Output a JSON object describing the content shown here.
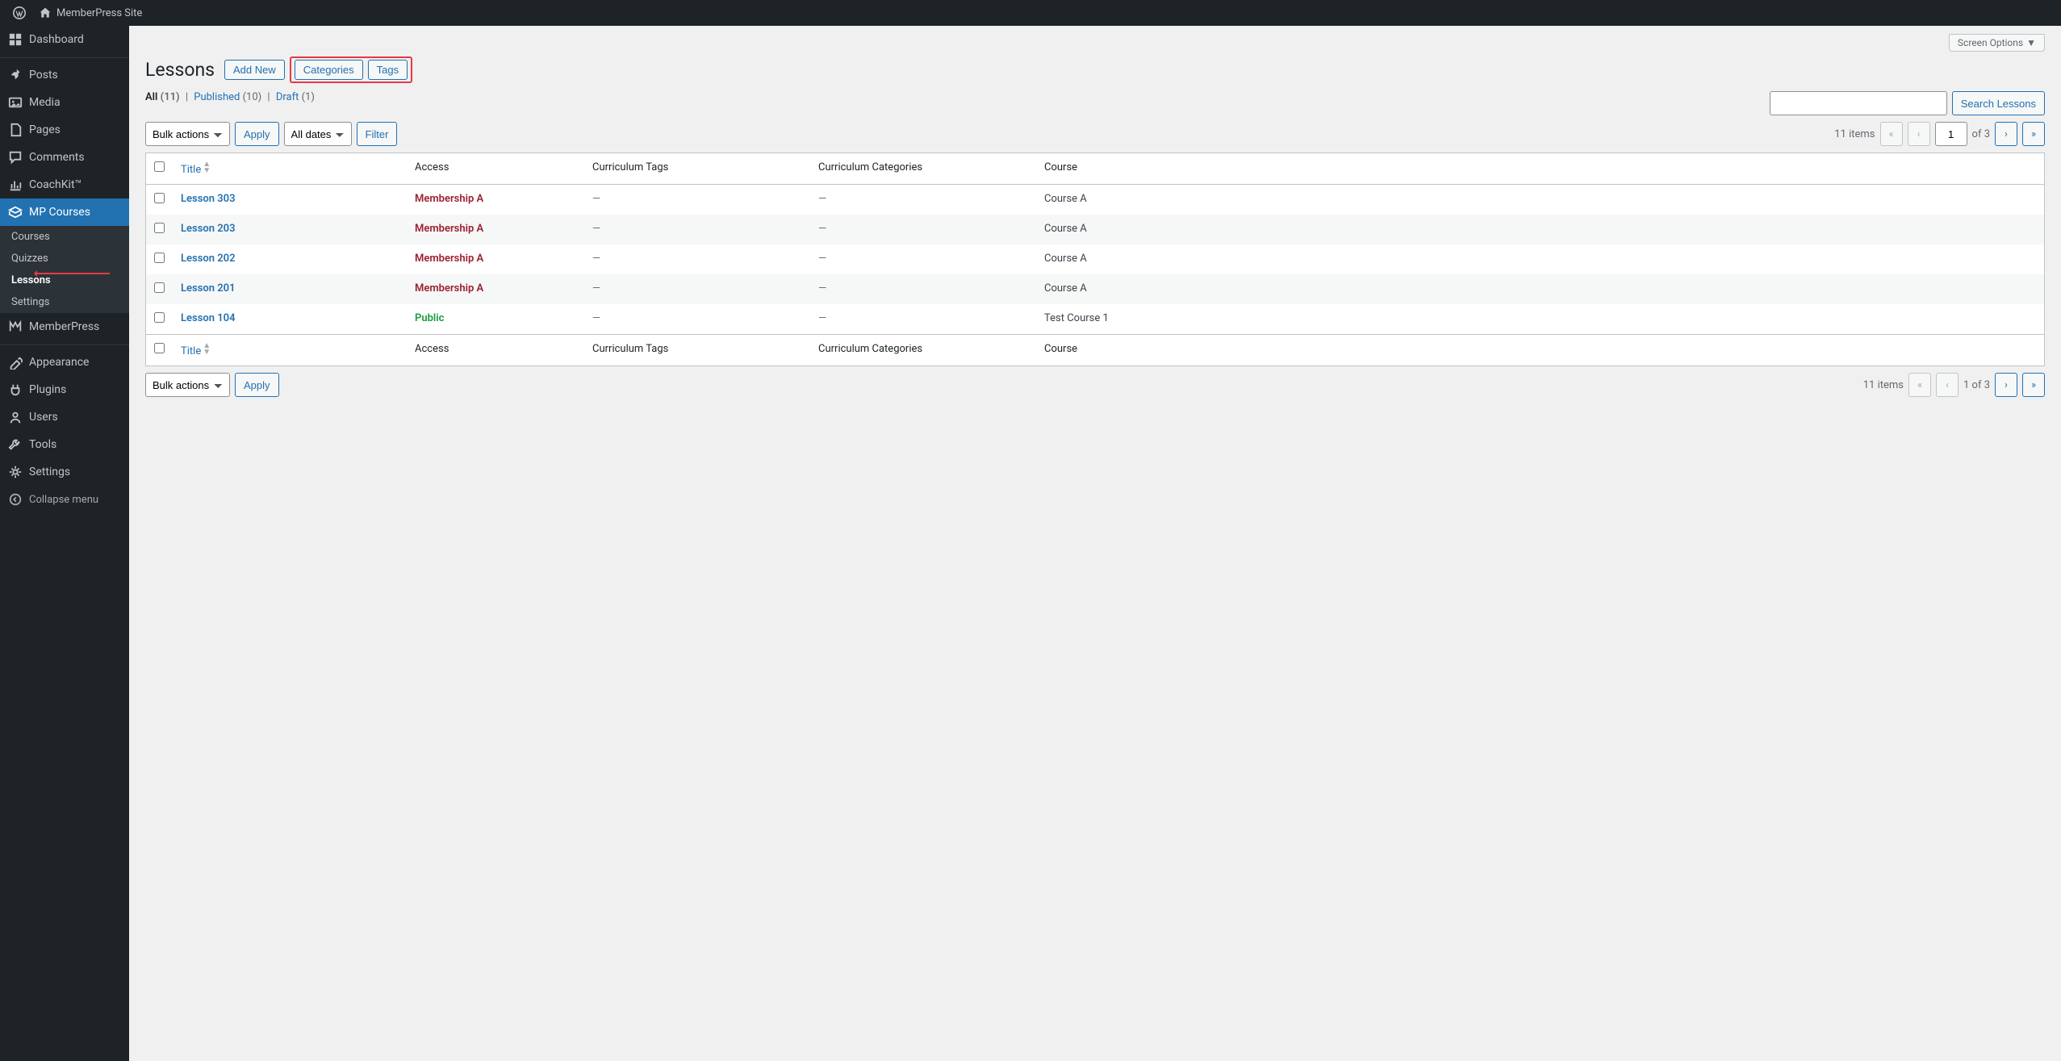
{
  "adminbar": {
    "site_name": "MemberPress Site"
  },
  "sidebar": {
    "items": [
      {
        "label": "Dashboard",
        "icon": "dashboard"
      },
      {
        "label": "Posts",
        "icon": "pin"
      },
      {
        "label": "Media",
        "icon": "media"
      },
      {
        "label": "Pages",
        "icon": "page"
      },
      {
        "label": "Comments",
        "icon": "comment"
      },
      {
        "label": "CoachKit™",
        "icon": "chart"
      },
      {
        "label": "MP Courses",
        "icon": "courses",
        "current": true,
        "submenu": [
          {
            "label": "Courses"
          },
          {
            "label": "Quizzes"
          },
          {
            "label": "Lessons",
            "current": true
          },
          {
            "label": "Settings"
          }
        ]
      },
      {
        "label": "MemberPress",
        "icon": "memberpress"
      },
      {
        "label": "Appearance",
        "icon": "appearance"
      },
      {
        "label": "Plugins",
        "icon": "plugin"
      },
      {
        "label": "Users",
        "icon": "user"
      },
      {
        "label": "Tools",
        "icon": "tools"
      },
      {
        "label": "Settings",
        "icon": "settings"
      },
      {
        "label": "Collapse menu",
        "icon": "collapse",
        "collapse": true
      }
    ]
  },
  "screen_options_label": "Screen Options",
  "header": {
    "title": "Lessons",
    "add_new": "Add New",
    "categories": "Categories",
    "tags": "Tags"
  },
  "filters": {
    "all_label": "All",
    "all_count": "(11)",
    "published_label": "Published",
    "published_count": "(10)",
    "draft_label": "Draft",
    "draft_count": "(1)"
  },
  "search": {
    "button": "Search Lessons"
  },
  "bulk": {
    "label": "Bulk actions",
    "apply": "Apply",
    "dates": "All dates",
    "filter": "Filter"
  },
  "pagination_top": {
    "items_text": "11 items",
    "current": "1",
    "of_total": "of 3"
  },
  "pagination_bottom": {
    "items_text": "11 items",
    "range": "1 of 3"
  },
  "columns": {
    "title": "Title",
    "access": "Access",
    "tags": "Curriculum Tags",
    "cats": "Curriculum Categories",
    "course": "Course"
  },
  "rows": [
    {
      "title": "Lesson 303",
      "access": "Membership A",
      "access_type": "membership",
      "tags": "—",
      "cats": "—",
      "course": "Course A"
    },
    {
      "title": "Lesson 203",
      "access": "Membership A",
      "access_type": "membership",
      "tags": "—",
      "cats": "—",
      "course": "Course A"
    },
    {
      "title": "Lesson 202",
      "access": "Membership A",
      "access_type": "membership",
      "tags": "—",
      "cats": "—",
      "course": "Course A"
    },
    {
      "title": "Lesson 201",
      "access": "Membership A",
      "access_type": "membership",
      "tags": "—",
      "cats": "—",
      "course": "Course A"
    },
    {
      "title": "Lesson 104",
      "access": "Public",
      "access_type": "public",
      "tags": "—",
      "cats": "—",
      "course": "Test Course 1"
    }
  ]
}
